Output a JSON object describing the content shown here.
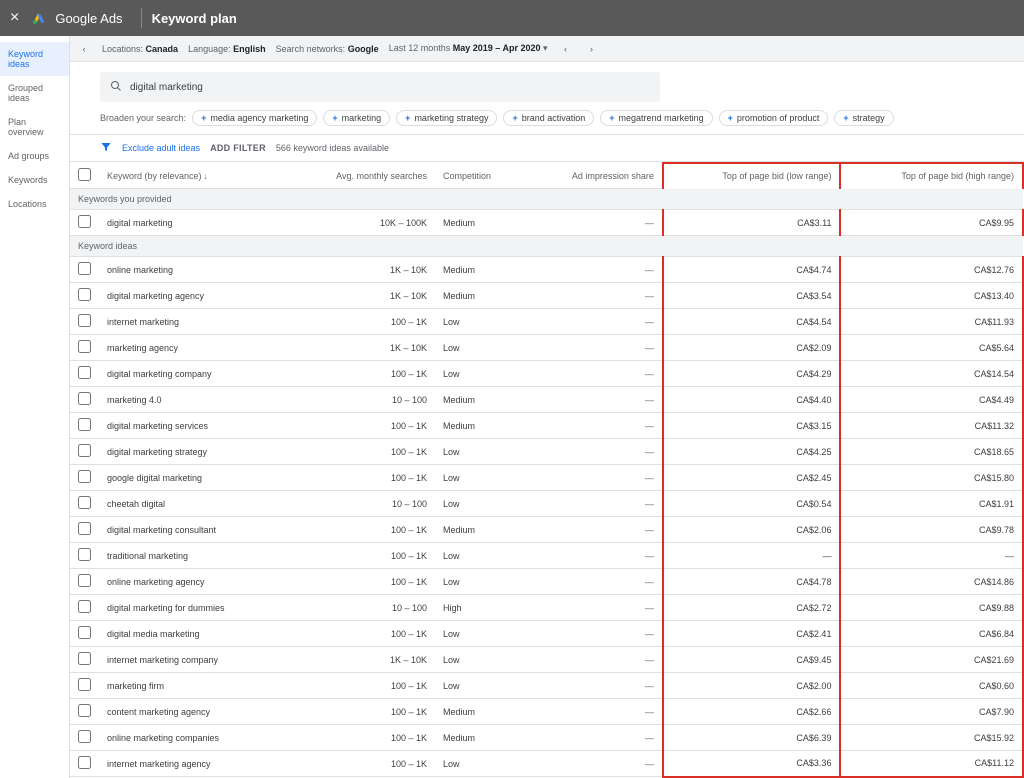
{
  "topbar": {
    "brand": "Google Ads",
    "title": "Keyword plan"
  },
  "sidebar": {
    "items": [
      {
        "label": "Keyword ideas",
        "active": true
      },
      {
        "label": "Grouped ideas",
        "active": false
      },
      {
        "label": "Plan overview",
        "active": false
      },
      {
        "label": "Ad groups",
        "active": false
      },
      {
        "label": "Keywords",
        "active": false
      },
      {
        "label": "Locations",
        "active": false
      }
    ]
  },
  "toolbar": {
    "locations_label": "Locations:",
    "locations_value": "Canada",
    "language_label": "Language:",
    "language_value": "English",
    "networks_label": "Search networks:",
    "networks_value": "Google",
    "range_label": "Last 12 months",
    "range_value": "May 2019 – Apr 2020"
  },
  "search": {
    "value": "digital marketing"
  },
  "broaden": {
    "label": "Broaden your search:",
    "chips": [
      "media agency marketing",
      "marketing",
      "marketing strategy",
      "brand activation",
      "megatrend marketing",
      "promotion of product",
      "strategy"
    ]
  },
  "filters": {
    "exclude": "Exclude adult ideas",
    "add": "ADD FILTER",
    "count": "566 keyword ideas available"
  },
  "table": {
    "headers": {
      "keyword": "Keyword (by relevance)",
      "searches": "Avg. monthly searches",
      "competition": "Competition",
      "impression": "Ad impression share",
      "low": "Top of page bid (low range)",
      "high": "Top of page bid (high range)"
    },
    "section_provided": "Keywords you provided",
    "section_ideas": "Keyword ideas",
    "provided": [
      {
        "kw": "digital marketing",
        "searches": "10K – 100K",
        "comp": "Medium",
        "imp": "—",
        "low": "CA$3.11",
        "high": "CA$9.95"
      }
    ],
    "ideas": [
      {
        "kw": "online marketing",
        "searches": "1K – 10K",
        "comp": "Medium",
        "imp": "—",
        "low": "CA$4.74",
        "high": "CA$12.76"
      },
      {
        "kw": "digital marketing agency",
        "searches": "1K – 10K",
        "comp": "Medium",
        "imp": "—",
        "low": "CA$3.54",
        "high": "CA$13.40"
      },
      {
        "kw": "internet marketing",
        "searches": "100 – 1K",
        "comp": "Low",
        "imp": "—",
        "low": "CA$4.54",
        "high": "CA$11.93"
      },
      {
        "kw": "marketing agency",
        "searches": "1K – 10K",
        "comp": "Low",
        "imp": "—",
        "low": "CA$2.09",
        "high": "CA$5.64"
      },
      {
        "kw": "digital marketing company",
        "searches": "100 – 1K",
        "comp": "Low",
        "imp": "—",
        "low": "CA$4.29",
        "high": "CA$14.54"
      },
      {
        "kw": "marketing 4.0",
        "searches": "10 – 100",
        "comp": "Medium",
        "imp": "—",
        "low": "CA$4.40",
        "high": "CA$4.49"
      },
      {
        "kw": "digital marketing services",
        "searches": "100 – 1K",
        "comp": "Medium",
        "imp": "—",
        "low": "CA$3.15",
        "high": "CA$11.32"
      },
      {
        "kw": "digital marketing strategy",
        "searches": "100 – 1K",
        "comp": "Low",
        "imp": "—",
        "low": "CA$4.25",
        "high": "CA$18.65"
      },
      {
        "kw": "google digital marketing",
        "searches": "100 – 1K",
        "comp": "Low",
        "imp": "—",
        "low": "CA$2.45",
        "high": "CA$15.80"
      },
      {
        "kw": "cheetah digital",
        "searches": "10 – 100",
        "comp": "Low",
        "imp": "—",
        "low": "CA$0.54",
        "high": "CA$1.91"
      },
      {
        "kw": "digital marketing consultant",
        "searches": "100 – 1K",
        "comp": "Medium",
        "imp": "—",
        "low": "CA$2.06",
        "high": "CA$9.78"
      },
      {
        "kw": "traditional marketing",
        "searches": "100 – 1K",
        "comp": "Low",
        "imp": "—",
        "low": "—",
        "high": "—"
      },
      {
        "kw": "online marketing agency",
        "searches": "100 – 1K",
        "comp": "Low",
        "imp": "—",
        "low": "CA$4.78",
        "high": "CA$14.86"
      },
      {
        "kw": "digital marketing for dummies",
        "searches": "10 – 100",
        "comp": "High",
        "imp": "—",
        "low": "CA$2.72",
        "high": "CA$9.88"
      },
      {
        "kw": "digital media marketing",
        "searches": "100 – 1K",
        "comp": "Low",
        "imp": "—",
        "low": "CA$2.41",
        "high": "CA$6.84"
      },
      {
        "kw": "internet marketing company",
        "searches": "1K – 10K",
        "comp": "Low",
        "imp": "—",
        "low": "CA$9.45",
        "high": "CA$21.69"
      },
      {
        "kw": "marketing firm",
        "searches": "100 – 1K",
        "comp": "Low",
        "imp": "—",
        "low": "CA$2.00",
        "high": "CA$0.60"
      },
      {
        "kw": "content marketing agency",
        "searches": "100 – 1K",
        "comp": "Medium",
        "imp": "—",
        "low": "CA$2.66",
        "high": "CA$7.90"
      },
      {
        "kw": "online marketing companies",
        "searches": "100 – 1K",
        "comp": "Medium",
        "imp": "—",
        "low": "CA$6.39",
        "high": "CA$15.92"
      },
      {
        "kw": "internet marketing agency",
        "searches": "100 – 1K",
        "comp": "Low",
        "imp": "—",
        "low": "CA$3.36",
        "high": "CA$11.12"
      }
    ]
  }
}
